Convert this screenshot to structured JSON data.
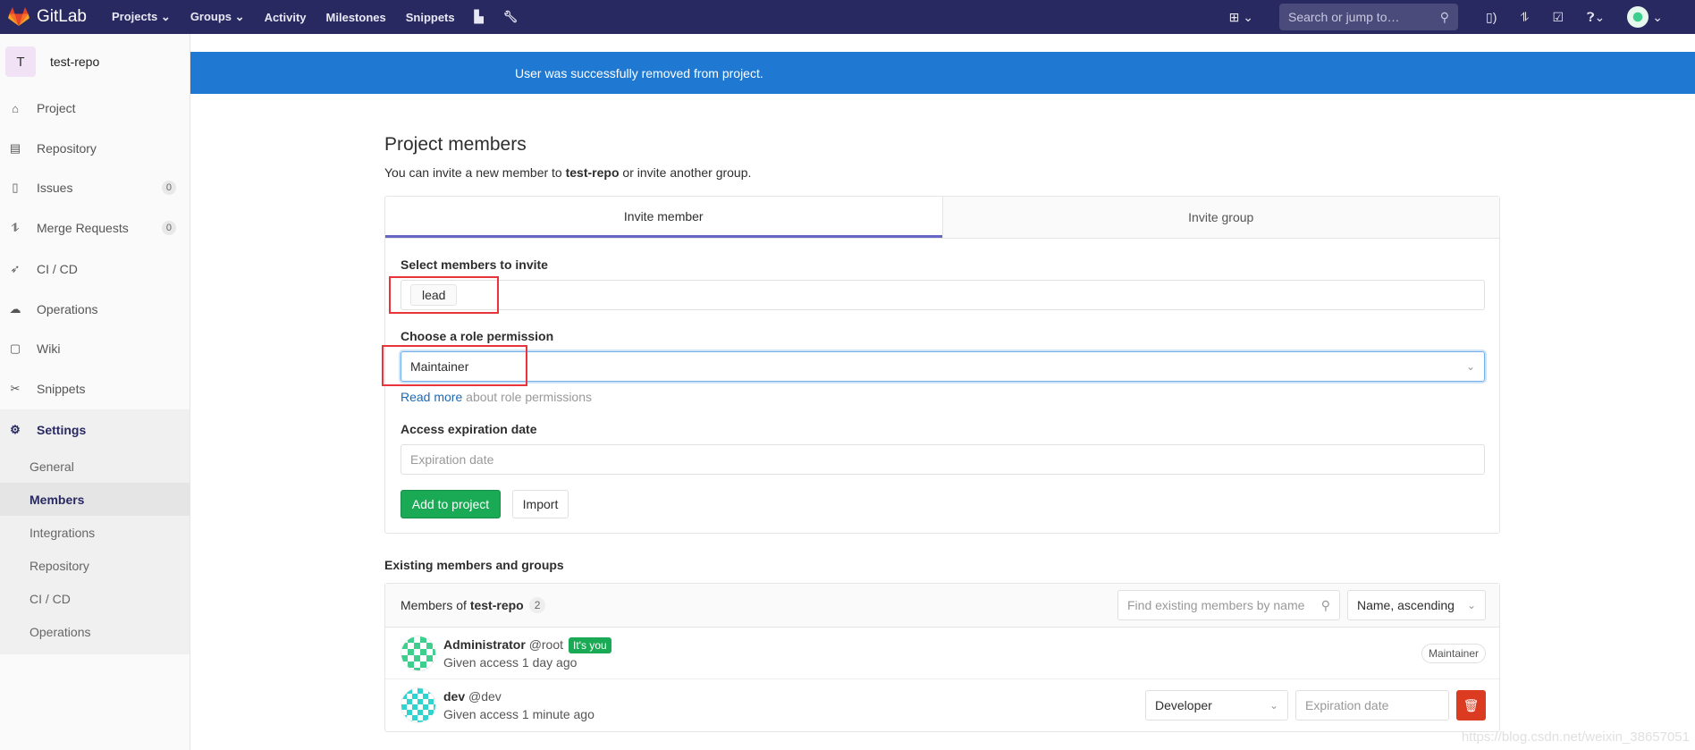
{
  "navbar": {
    "brand": "GitLab",
    "links": [
      "Projects",
      "Groups",
      "Activity",
      "Milestones",
      "Snippets"
    ],
    "icons": [
      "chart-icon",
      "wrench-icon"
    ],
    "search_placeholder": "Search or jump to…",
    "brand_color": "#292961"
  },
  "sidebar": {
    "project_initial": "T",
    "project_name": "test-repo",
    "items": [
      {
        "label": "Project",
        "icon": "home-icon"
      },
      {
        "label": "Repository",
        "icon": "doc-icon"
      },
      {
        "label": "Issues",
        "icon": "issues-icon",
        "badge": "0"
      },
      {
        "label": "Merge Requests",
        "icon": "merge-request-icon",
        "badge": "0"
      },
      {
        "label": "CI / CD",
        "icon": "rocket-icon"
      },
      {
        "label": "Operations",
        "icon": "cloud-gear-icon"
      },
      {
        "label": "Wiki",
        "icon": "book-icon"
      },
      {
        "label": "Snippets",
        "icon": "scissors-icon"
      },
      {
        "label": "Settings",
        "icon": "gear-icon"
      }
    ],
    "settings_sub": [
      "General",
      "Members",
      "Integrations",
      "Repository",
      "CI / CD",
      "Operations"
    ],
    "active_sub": "Members"
  },
  "flash": {
    "message": "User was successfully removed from project.",
    "color": "#1f78d1"
  },
  "page": {
    "title": "Project members",
    "desc_pre": "You can invite a new member to ",
    "desc_project": "test-repo",
    "desc_post": " or invite another group."
  },
  "invite": {
    "tabs": [
      "Invite member",
      "Invite group"
    ],
    "select_label": "Select members to invite",
    "selected_member": "lead",
    "role_label": "Choose a role permission",
    "role_value": "Maintainer",
    "read_more": "Read more",
    "read_more_rest": " about role permissions",
    "expiry_label": "Access expiration date",
    "expiry_placeholder": "Expiration date",
    "add_button": "Add to project",
    "import_button": "Import"
  },
  "existing": {
    "heading": "Existing members and groups",
    "members_of": "Members of ",
    "project": "test-repo",
    "count": "2",
    "search_placeholder": "Find existing members by name",
    "sort": "Name, ascending",
    "members": [
      {
        "name": "Administrator",
        "username": "@root",
        "badge": "It's you",
        "access": "Given access 1 day ago",
        "role": "Maintainer"
      },
      {
        "name": "dev",
        "username": "@dev",
        "access": "Given access 1 minute ago",
        "role": "Developer",
        "expiry_placeholder": "Expiration date"
      }
    ]
  },
  "watermark": "https://blog.csdn.net/weixin_38657051"
}
